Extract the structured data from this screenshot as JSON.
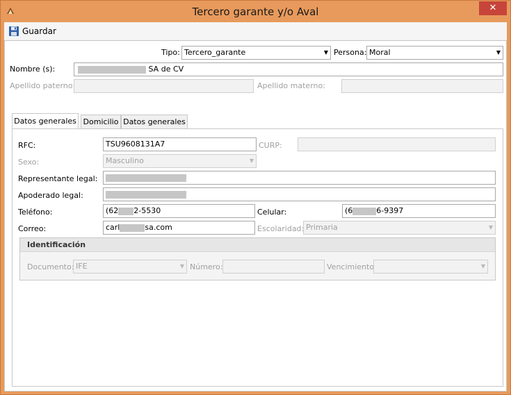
{
  "window": {
    "title": "Tercero garante y/o Aval",
    "close_glyph": "✕",
    "app_icon": "app-logo-icon"
  },
  "toolbar": {
    "save_label": "Guardar",
    "save_icon": "floppy-disk-icon"
  },
  "form": {
    "tipo_label": "Tipo:",
    "tipo_value": "Tercero_garante",
    "persona_label": "Persona:",
    "persona_value": "Moral",
    "nombre_label": "Nombre (s):",
    "nombre_value_visible": "SA de CV",
    "apellido_paterno_label": "Apellido paterno:",
    "apellido_materno_label": "Apellido materno:"
  },
  "tabs": [
    {
      "label": "Datos generales",
      "active": true
    },
    {
      "label": "Domicilio",
      "active": false
    },
    {
      "label": "Datos generales",
      "active": false
    }
  ],
  "datos": {
    "rfc_label": "RFC:",
    "rfc_value": "TSU9608131A7",
    "curp_label": "CURP:",
    "sexo_label": "Sexo:",
    "sexo_value": "Masculino",
    "rep_label": "Representante legal:",
    "apo_label": "Apoderado legal:",
    "tel_label": "Teléfono:",
    "tel_prefix": "(62",
    "tel_suffix": "2-5530",
    "cel_label": "Celular:",
    "cel_prefix": "(6",
    "cel_suffix": "6-9397",
    "correo_label": "Correo:",
    "correo_prefix": "carl",
    "correo_suffix": "sa.com",
    "escolaridad_label": "Escolaridad:",
    "escolaridad_value": "Primaria"
  },
  "identificacion": {
    "title": "Identificación",
    "documento_label": "Documento:",
    "documento_value": "IFE",
    "numero_label": "Número:",
    "vencimiento_label": "Vencimiento:"
  },
  "colors": {
    "titlebar": "#e89a5c",
    "close": "#c7443a"
  }
}
